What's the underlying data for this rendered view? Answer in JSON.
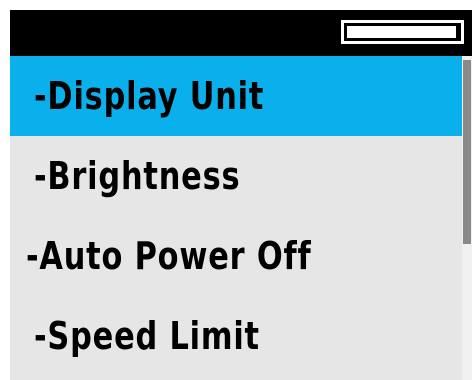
{
  "menu": {
    "items": [
      {
        "label": "-Display Unit",
        "selected": true
      },
      {
        "label": "-Brightness",
        "selected": false
      },
      {
        "label": "-Auto Power Off",
        "selected": false
      },
      {
        "label": "-Speed Limit",
        "selected": false
      }
    ]
  },
  "battery": {
    "level": 0.98
  },
  "colors": {
    "selection": "#0ab0ec",
    "list_background": "#e6e6e6",
    "status_bar": "#000000",
    "scroll_thumb": "#8a8a8a"
  }
}
